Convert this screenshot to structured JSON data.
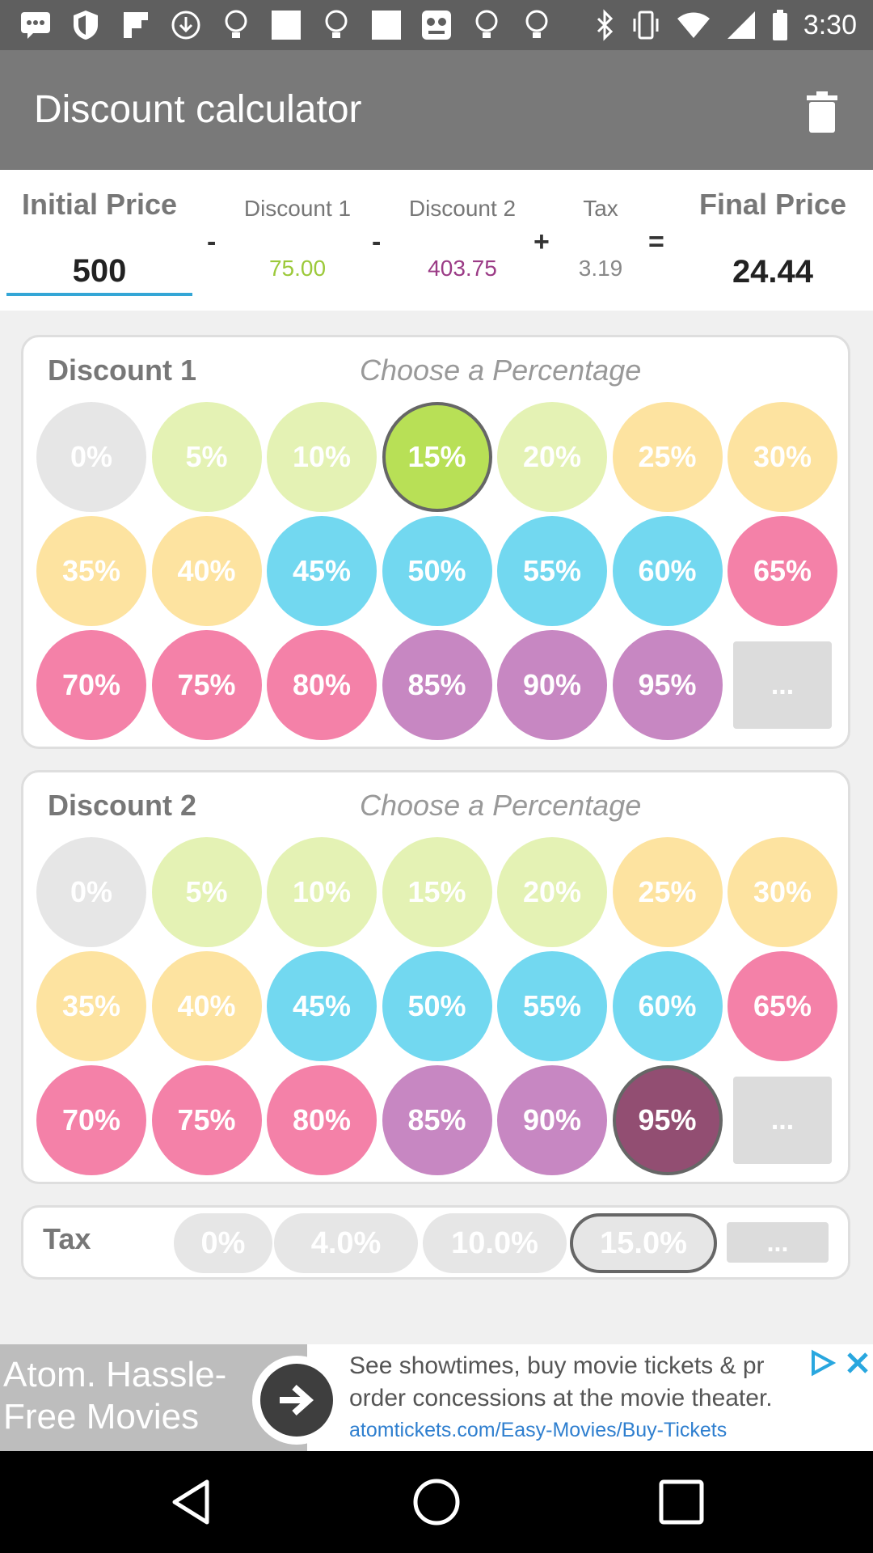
{
  "status_bar": {
    "time": "3:30",
    "left_icons": [
      "chat-icon",
      "shield-icon",
      "flipboard-icon",
      "download-icon",
      "lightbulb-icon",
      "square-icon",
      "lightbulb-icon",
      "square-icon",
      "game-icon",
      "lightbulb-icon",
      "lightbulb-icon"
    ],
    "right_icons": [
      "bluetooth-icon",
      "vibrate-icon",
      "wifi-icon",
      "signal-icon",
      "battery-icon"
    ]
  },
  "app_bar": {
    "title": "Discount calculator",
    "delete_icon": "trash-icon"
  },
  "summary": {
    "initial_price_label": "Initial Price",
    "initial_price_value": "500",
    "discount1_label": "Discount 1",
    "discount1_value": "75.00",
    "discount2_label": "Discount 2",
    "discount2_value": "403.75",
    "tax_label": "Tax",
    "tax_value": "3.19",
    "final_price_label": "Final Price",
    "final_price_value": "24.44",
    "op_minus": "-",
    "op_plus": "+",
    "op_equals": "=",
    "colors": {
      "discount1": "#9cc93a",
      "discount2": "#9b3b86",
      "tax": "#888888",
      "underline": "#34a6d6"
    }
  },
  "discount1": {
    "title": "Discount 1",
    "hint": "Choose a Percentage",
    "options": [
      "0%",
      "5%",
      "10%",
      "15%",
      "20%",
      "25%",
      "30%",
      "35%",
      "40%",
      "45%",
      "50%",
      "55%",
      "60%",
      "65%",
      "70%",
      "75%",
      "80%",
      "85%",
      "90%",
      "95%"
    ],
    "selected": "15%",
    "more_label": "..."
  },
  "discount2": {
    "title": "Discount 2",
    "hint": "Choose a Percentage",
    "options": [
      "0%",
      "5%",
      "10%",
      "15%",
      "20%",
      "25%",
      "30%",
      "35%",
      "40%",
      "45%",
      "50%",
      "55%",
      "60%",
      "65%",
      "70%",
      "75%",
      "80%",
      "85%",
      "90%",
      "95%"
    ],
    "selected": "95%",
    "more_label": "..."
  },
  "tax": {
    "title": "Tax",
    "options": [
      "0%",
      "4.0%",
      "10.0%",
      "15.0%"
    ],
    "selected": "15.0%",
    "more_label": "..."
  },
  "ad": {
    "left_text": "Atom. Hassle-Free Movies",
    "line1": "See showtimes, buy movie tickets & pr",
    "line2": "order concessions at the movie theater.",
    "url": "atomtickets.com/Easy-Movies/Buy-Tickets"
  },
  "nav": {
    "back": "back-icon",
    "home": "home-icon",
    "recents": "recents-icon"
  }
}
